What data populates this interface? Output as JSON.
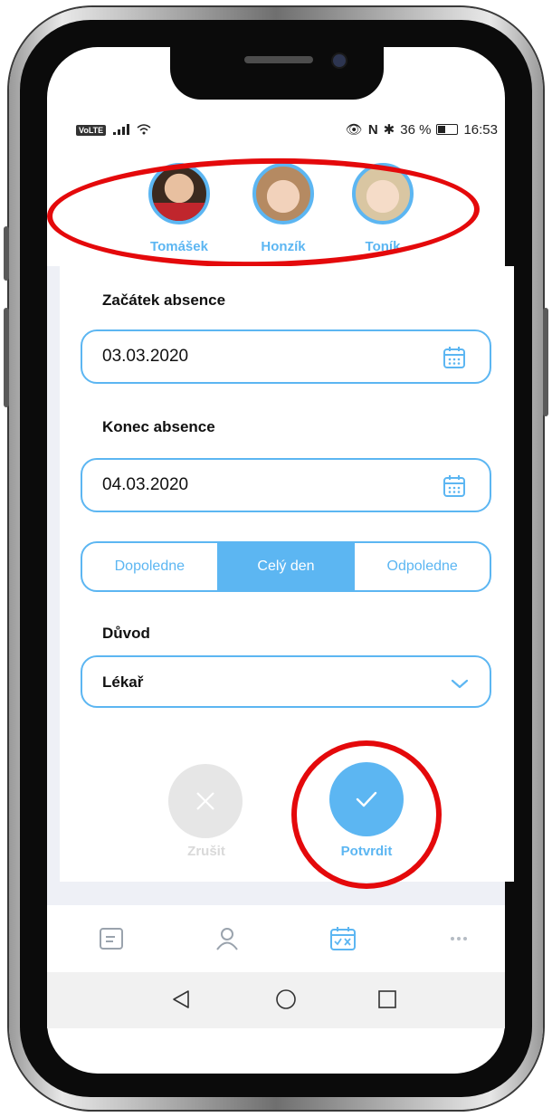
{
  "status_bar": {
    "network": "VoLTE",
    "battery": "36 %",
    "time": "16:53"
  },
  "kids": [
    {
      "name": "Tomášek",
      "icon": "child-avatar-1"
    },
    {
      "name": "Honzík",
      "icon": "child-avatar-2"
    },
    {
      "name": "Toník",
      "icon": "child-avatar-3"
    }
  ],
  "form": {
    "start_label": "Začátek absence",
    "start_value": "03.03.2020",
    "end_label": "Konec absence",
    "end_value": "04.03.2020",
    "segments": [
      "Dopoledne",
      "Celý den",
      "Odpoledne"
    ],
    "selected_segment": "Celý den",
    "reason_label": "Důvod",
    "reason_value": "Lékař"
  },
  "actions": {
    "cancel_label": "Zrušit",
    "confirm_label": "Potvrdit"
  },
  "bottom_nav": [
    "list-icon",
    "person-icon",
    "calendar-icon",
    "more-icon"
  ],
  "colors": {
    "accent": "#5cb6f2",
    "annotation": "#e4090b",
    "disabled": "#e6e6e6"
  }
}
